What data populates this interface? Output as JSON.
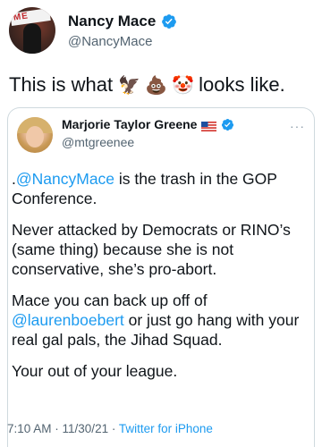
{
  "tweet": {
    "author": {
      "name": "Nancy Mace",
      "handle": "@NancyMace",
      "avatar_banner_text": "ME",
      "verified_icon": "verified-badge-icon"
    },
    "text_before": "This is what",
    "emojis": [
      {
        "name": "eagle-emoji",
        "glyph": "🦅"
      },
      {
        "name": "poop-emoji",
        "glyph": "💩"
      },
      {
        "name": "clown-emoji",
        "glyph": "🤡"
      }
    ],
    "text_after": "looks like."
  },
  "quoted": {
    "author": {
      "name": "Marjorie Taylor Greene",
      "handle": "@mtgreenee",
      "flag_icon": "us-flag-icon",
      "verified_icon": "verified-badge-icon"
    },
    "more_label": "···",
    "paragraphs": [
      {
        "prefix": ".",
        "mention": "@NancyMace",
        "rest": " is the trash in the GOP Conference."
      },
      {
        "text": "Never attacked by Democrats or RINO’s (same thing) because she is not conservative, she’s pro-abort."
      },
      {
        "text_before": "Mace you can back up off of ",
        "mention": "@laurenboebert",
        "text_after": " or just go hang with your real gal pals, the Jihad Squad."
      },
      {
        "text": "Your out of your league."
      }
    ],
    "time": "7:10 AM",
    "separator": " · ",
    "date": "11/30/21",
    "source": "Twitter for iPhone"
  },
  "colors": {
    "accent": "#1d9bf0",
    "text": "#0f1419",
    "muted": "#536471",
    "border": "#cfd9de"
  }
}
